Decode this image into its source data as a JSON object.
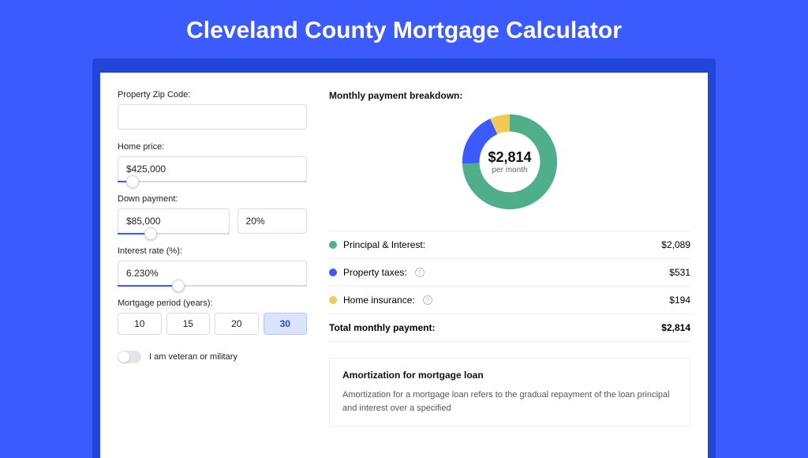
{
  "header": {
    "title": "Cleveland County Mortgage Calculator"
  },
  "form": {
    "zip_label": "Property Zip Code:",
    "zip_value": "",
    "home_price_label": "Home price:",
    "home_price_value": "$425,000",
    "home_price_slider_pct": 8,
    "down_payment_label": "Down payment:",
    "down_payment_amount": "$85,000",
    "down_payment_pct": "20%",
    "down_payment_slider_pct": 30,
    "interest_label": "Interest rate (%):",
    "interest_value": "6.230%",
    "interest_slider_pct": 32,
    "period_label": "Mortgage period (years):",
    "periods": [
      "10",
      "15",
      "20",
      "30"
    ],
    "period_selected": "30",
    "veteran_label": "I am veteran or military"
  },
  "breakdown": {
    "title": "Monthly payment breakdown:",
    "center_value": "$2,814",
    "center_sub": "per month",
    "items": [
      {
        "key": "principal_interest",
        "label": "Principal & Interest:",
        "value": "$2,089",
        "color": "#4FAF8A",
        "info": false
      },
      {
        "key": "property_taxes",
        "label": "Property taxes:",
        "value": "$531",
        "color": "#3B5BFF",
        "info": true
      },
      {
        "key": "home_insurance",
        "label": "Home insurance:",
        "value": "$194",
        "color": "#F2C955",
        "info": true
      }
    ],
    "total_label": "Total monthly payment:",
    "total_value": "$2,814"
  },
  "amortization": {
    "title": "Amortization for mortgage loan",
    "body": "Amortization for a mortgage loan refers to the gradual repayment of the loan principal and interest over a specified"
  },
  "chart_data": {
    "type": "pie",
    "title": "Monthly payment breakdown",
    "categories": [
      "Principal & Interest",
      "Property taxes",
      "Home insurance"
    ],
    "values": [
      2089,
      531,
      194
    ],
    "colors": [
      "#4FAF8A",
      "#3B5BFF",
      "#F2C955"
    ],
    "total": 2814,
    "center_label": "$2,814 per month"
  }
}
